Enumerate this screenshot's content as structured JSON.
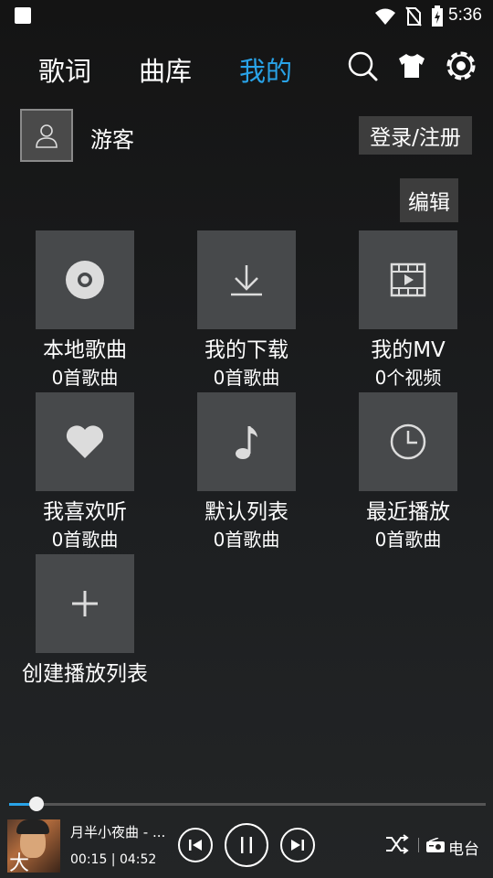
{
  "status_bar": {
    "time": "5:36"
  },
  "nav": {
    "tabs": [
      "歌词",
      "曲库",
      "我的"
    ],
    "active_index": 2,
    "accent": "#29a3e8"
  },
  "user": {
    "name": "游客",
    "login_label": "登录/注册"
  },
  "edit_label": "编辑",
  "items": [
    {
      "title": "本地歌曲",
      "count": "0首歌曲",
      "icon": "disc-icon"
    },
    {
      "title": "我的下载",
      "count": "0首歌曲",
      "icon": "download-icon"
    },
    {
      "title": "我的MV",
      "count": "0个视频",
      "icon": "film-icon"
    },
    {
      "title": "我喜欢听",
      "count": "0首歌曲",
      "icon": "heart-icon"
    },
    {
      "title": "默认列表",
      "count": "0首歌曲",
      "icon": "music-note-icon"
    },
    {
      "title": "最近播放",
      "count": "0首歌曲",
      "icon": "clock-icon"
    },
    {
      "title": "创建播放列表",
      "count": "",
      "icon": "plus-icon"
    }
  ],
  "player": {
    "song": "月半小夜曲 - ...",
    "elapsed": "00:15",
    "duration": "04:52",
    "time_text": "00:15 | 04:52",
    "progress": 0.058,
    "radio_label": "电台",
    "cover_glyph": "大"
  }
}
